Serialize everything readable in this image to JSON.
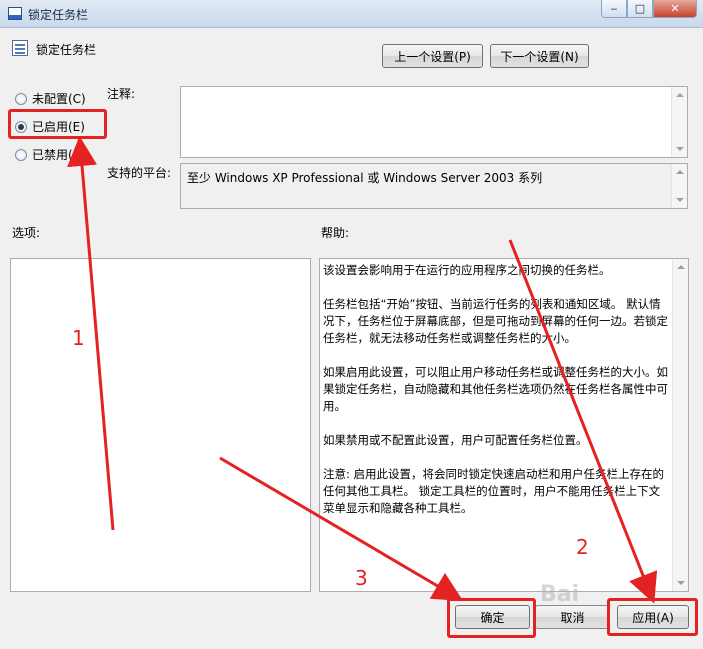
{
  "window": {
    "title": "锁定任务栏",
    "min_glyph": "‒",
    "max_glyph": "□",
    "close_glyph": "✕"
  },
  "header": {
    "policy_title": "锁定任务栏",
    "prev_button": "上一个设置(P)",
    "next_button": "下一个设置(N)"
  },
  "radios": [
    {
      "label": "未配置(C)",
      "checked": false
    },
    {
      "label": "已启用(E)",
      "checked": true
    },
    {
      "label": "已禁用(D",
      "checked": false
    }
  ],
  "labels": {
    "comment": "注释:",
    "platform": "支持的平台:",
    "options": "选项:",
    "help": "帮助:"
  },
  "platform_text": "至少 Windows XP Professional 或 Windows Server 2003 系列",
  "help_paragraphs": [
    "该设置会影响用于在运行的应用程序之间切换的任务栏。",
    "任务栏包括“开始”按钮、当前运行任务的列表和通知区域。 默认情况下，任务栏位于屏幕底部，但是可拖动到屏幕的任何一边。若锁定任务栏，就无法移动任务栏或调整任务栏的大小。",
    "如果启用此设置，可以阻止用户移动任务栏或调整任务栏的大小。如果锁定任务栏，自动隐藏和其他任务栏选项仍然在任务栏各属性中可用。",
    "如果禁用或不配置此设置，用户可配置任务栏位置。",
    "注意: 启用此设置，将会同时锁定快速启动栏和用户任务栏上存在的任何其他工具栏。 锁定工具栏的位置时，用户不能用任务栏上下文菜单显示和隐藏各种工具栏。"
  ],
  "footer": {
    "ok": "确定",
    "cancel": "取消",
    "apply": "应用(A)"
  },
  "annotations": {
    "step1": "1",
    "step2": "2",
    "step3": "3",
    "color": "#e52222"
  },
  "watermark": "Bai"
}
